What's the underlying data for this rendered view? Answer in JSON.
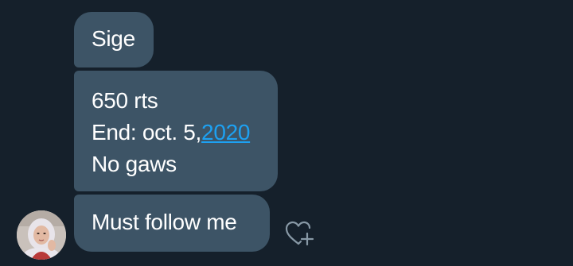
{
  "messages": [
    {
      "lines": [
        "Sige"
      ]
    },
    {
      "line1": "650 rts",
      "line2_prefix": "End: oct. 5,",
      "line2_link": "2020",
      "line3": "No gaws"
    },
    {
      "lines": [
        "Must follow me"
      ]
    }
  ],
  "icons": {
    "avatar": "user-avatar",
    "like": "heart-plus-icon"
  },
  "colors": {
    "background": "#15202b",
    "bubble": "#3d5466",
    "text": "#ffffff",
    "link": "#1da1f2"
  }
}
